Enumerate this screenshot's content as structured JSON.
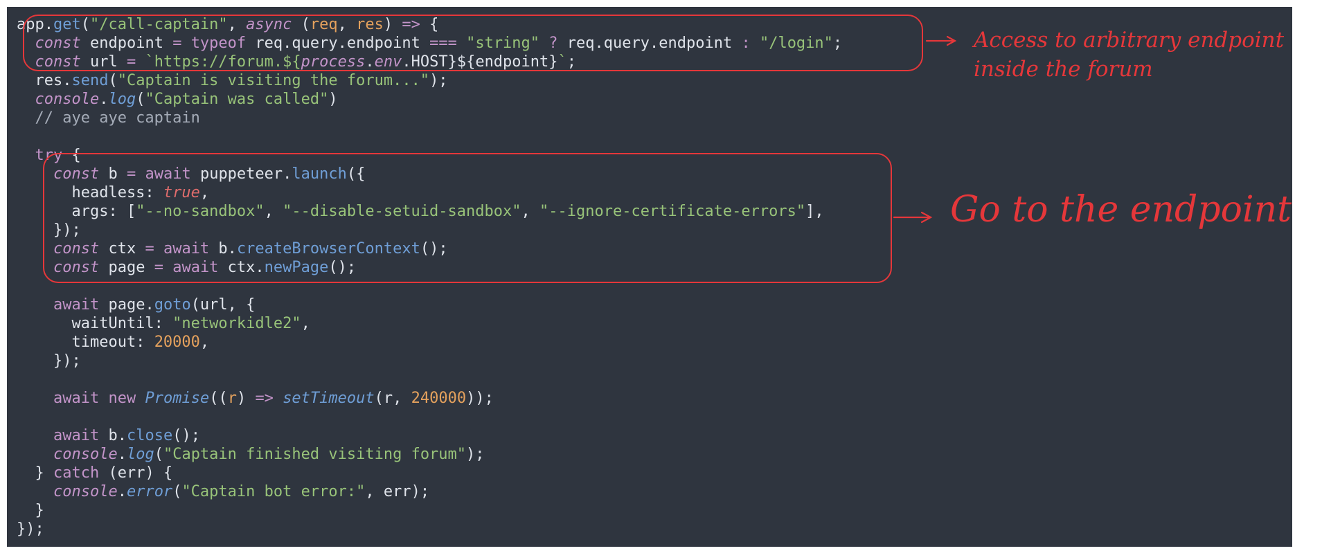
{
  "code": {
    "lines": [
      [
        [
          "pn",
          "app."
        ],
        [
          "fn",
          "get"
        ],
        [
          "pn",
          "("
        ],
        [
          "str",
          "\"/call-captain\""
        ],
        [
          "pn",
          ", "
        ],
        [
          "it",
          "async"
        ],
        [
          "pn",
          " ("
        ],
        [
          "prm",
          "req"
        ],
        [
          "pn",
          ", "
        ],
        [
          "prm",
          "res"
        ],
        [
          "pn",
          ") "
        ],
        [
          "op",
          "=>"
        ],
        [
          "pn",
          " {"
        ]
      ],
      [
        [
          "pn",
          "  "
        ],
        [
          "it",
          "const"
        ],
        [
          "pn",
          " endpoint "
        ],
        [
          "op",
          "="
        ],
        [
          "pn",
          " "
        ],
        [
          "kw",
          "typeof"
        ],
        [
          "pn",
          " req.query.endpoint "
        ],
        [
          "op",
          "==="
        ],
        [
          "pn",
          " "
        ],
        [
          "str",
          "\"string\""
        ],
        [
          "pn",
          " "
        ],
        [
          "op",
          "?"
        ],
        [
          "pn",
          " req.query.endpoint "
        ],
        [
          "op",
          ":"
        ],
        [
          "pn",
          " "
        ],
        [
          "str",
          "\"/login\""
        ],
        [
          "pn",
          ";"
        ]
      ],
      [
        [
          "pn",
          "  "
        ],
        [
          "it",
          "const"
        ],
        [
          "pn",
          " url "
        ],
        [
          "op",
          "="
        ],
        [
          "pn",
          " "
        ],
        [
          "str",
          "`https://forum.${"
        ],
        [
          "it",
          "process"
        ],
        [
          "pn",
          "."
        ],
        [
          "it",
          "env"
        ],
        [
          "pn",
          ".HOST}${endpoint}"
        ],
        [
          "str",
          "`"
        ],
        [
          "pn",
          ";"
        ]
      ],
      [
        [
          "pn",
          "  res."
        ],
        [
          "fn",
          "send"
        ],
        [
          "pn",
          "("
        ],
        [
          "str",
          "\"Captain is visiting the forum...\""
        ],
        [
          "pn",
          ");"
        ]
      ],
      [
        [
          "pn",
          "  "
        ],
        [
          "it",
          "console"
        ],
        [
          "pn",
          "."
        ],
        [
          "fni",
          "log"
        ],
        [
          "pn",
          "("
        ],
        [
          "str",
          "\"Captain was called\""
        ],
        [
          "pn",
          ")"
        ]
      ],
      [
        [
          "cm",
          "  // aye aye captain"
        ]
      ],
      [],
      [
        [
          "pn",
          "  "
        ],
        [
          "kw",
          "try"
        ],
        [
          "pn",
          " {"
        ]
      ],
      [
        [
          "pn",
          "    "
        ],
        [
          "it",
          "const"
        ],
        [
          "pn",
          " b "
        ],
        [
          "op",
          "="
        ],
        [
          "pn",
          " "
        ],
        [
          "kw",
          "await"
        ],
        [
          "pn",
          " puppeteer."
        ],
        [
          "fn",
          "launch"
        ],
        [
          "pn",
          "({"
        ]
      ],
      [
        [
          "pn",
          "      headless: "
        ],
        [
          "boo",
          "true"
        ],
        [
          "pn",
          ","
        ]
      ],
      [
        [
          "pn",
          "      args: ["
        ],
        [
          "str",
          "\"--no-sandbox\""
        ],
        [
          "pn",
          ", "
        ],
        [
          "str",
          "\"--disable-setuid-sandbox\""
        ],
        [
          "pn",
          ", "
        ],
        [
          "str",
          "\"--ignore-certificate-errors\""
        ],
        [
          "pn",
          "],"
        ]
      ],
      [
        [
          "pn",
          "    });"
        ]
      ],
      [
        [
          "pn",
          "    "
        ],
        [
          "it",
          "const"
        ],
        [
          "pn",
          " ctx "
        ],
        [
          "op",
          "="
        ],
        [
          "pn",
          " "
        ],
        [
          "kw",
          "await"
        ],
        [
          "pn",
          " b."
        ],
        [
          "fn",
          "createBrowserContext"
        ],
        [
          "pn",
          "();"
        ]
      ],
      [
        [
          "pn",
          "    "
        ],
        [
          "it",
          "const"
        ],
        [
          "pn",
          " page "
        ],
        [
          "op",
          "="
        ],
        [
          "pn",
          " "
        ],
        [
          "kw",
          "await"
        ],
        [
          "pn",
          " ctx."
        ],
        [
          "fn",
          "newPage"
        ],
        [
          "pn",
          "();"
        ]
      ],
      [],
      [
        [
          "pn",
          "    "
        ],
        [
          "kw",
          "await"
        ],
        [
          "pn",
          " page."
        ],
        [
          "fn",
          "goto"
        ],
        [
          "pn",
          "(url, {"
        ]
      ],
      [
        [
          "pn",
          "      waitUntil: "
        ],
        [
          "str",
          "\"networkidle2\""
        ],
        [
          "pn",
          ","
        ]
      ],
      [
        [
          "pn",
          "      timeout: "
        ],
        [
          "num",
          "20000"
        ],
        [
          "pn",
          ","
        ]
      ],
      [
        [
          "pn",
          "    });"
        ]
      ],
      [],
      [
        [
          "pn",
          "    "
        ],
        [
          "kw",
          "await"
        ],
        [
          "pn",
          " "
        ],
        [
          "kw",
          "new"
        ],
        [
          "pn",
          " "
        ],
        [
          "fni",
          "Promise"
        ],
        [
          "pn",
          "(("
        ],
        [
          "prm",
          "r"
        ],
        [
          "pn",
          ") "
        ],
        [
          "op",
          "=>"
        ],
        [
          "pn",
          " "
        ],
        [
          "fni",
          "setTimeout"
        ],
        [
          "pn",
          "(r, "
        ],
        [
          "num",
          "240000"
        ],
        [
          "pn",
          "));"
        ]
      ],
      [],
      [
        [
          "pn",
          "    "
        ],
        [
          "kw",
          "await"
        ],
        [
          "pn",
          " b."
        ],
        [
          "fn",
          "close"
        ],
        [
          "pn",
          "();"
        ]
      ],
      [
        [
          "pn",
          "    "
        ],
        [
          "it",
          "console"
        ],
        [
          "pn",
          "."
        ],
        [
          "fni",
          "log"
        ],
        [
          "pn",
          "("
        ],
        [
          "str",
          "\"Captain finished visiting forum\""
        ],
        [
          "pn",
          ");"
        ]
      ],
      [
        [
          "pn",
          "  } "
        ],
        [
          "kw",
          "catch"
        ],
        [
          "pn",
          " (err) {"
        ]
      ],
      [
        [
          "pn",
          "    "
        ],
        [
          "it",
          "console"
        ],
        [
          "pn",
          "."
        ],
        [
          "fni",
          "error"
        ],
        [
          "pn",
          "("
        ],
        [
          "str",
          "\"Captain bot error:\""
        ],
        [
          "pn",
          ", err);"
        ]
      ],
      [
        [
          "pn",
          "  }"
        ]
      ],
      [
        [
          "pn",
          "});"
        ]
      ]
    ]
  },
  "annotations": {
    "note1_line1": "Access to arbitrary endpoint",
    "note1_line2": "inside the forum",
    "note2": "Go to the endpoint",
    "color": "#e5373a"
  }
}
